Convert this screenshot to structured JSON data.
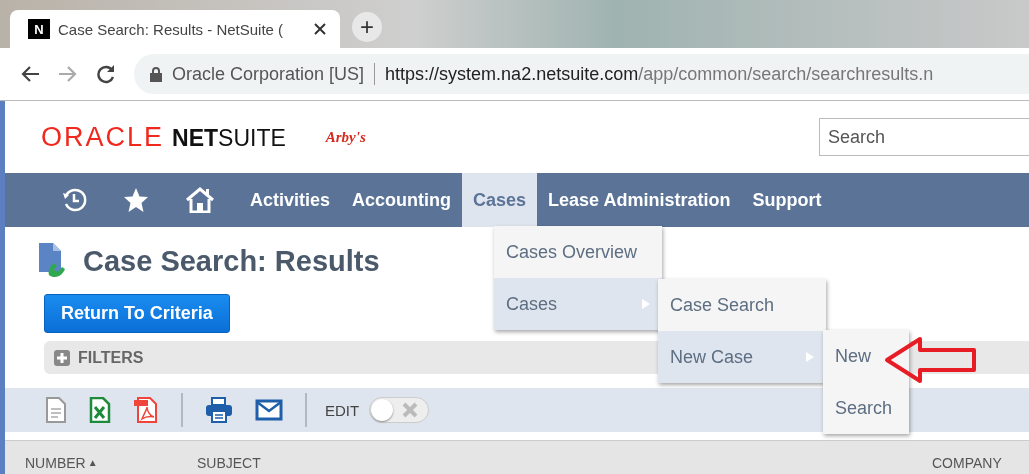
{
  "browser": {
    "tab": {
      "title": "Case Search: Results - NetSuite (",
      "favicon": "N"
    },
    "new_tab": "+",
    "address": {
      "security": "Oracle Corporation [US]",
      "url_host": "https://system.na2.netsuite.com",
      "url_path": "/app/common/search/searchresults.n"
    }
  },
  "header": {
    "logo": {
      "oracle": "ORACLE",
      "net": "NET",
      "suite": "SUITE"
    },
    "company_logo": "Arby's",
    "search": {
      "placeholder": "Search"
    }
  },
  "nav": {
    "icons": [
      {
        "kind": "recent"
      },
      {
        "kind": "star"
      },
      {
        "kind": "home"
      }
    ],
    "items": [
      {
        "label": "Activities",
        "selected": false
      },
      {
        "label": "Accounting",
        "selected": false
      },
      {
        "label": "Cases",
        "selected": true
      },
      {
        "label": "Lease Administration",
        "selected": false
      },
      {
        "label": "Support",
        "selected": false
      }
    ]
  },
  "menus": [
    {
      "items": [
        {
          "label": "Cases Overview",
          "selected": false,
          "submenu": false
        },
        {
          "label": "Cases",
          "selected": true,
          "submenu": true
        }
      ]
    },
    {
      "items": [
        {
          "label": "Case Search",
          "selected": false,
          "submenu": false
        },
        {
          "label": "New Case",
          "selected": true,
          "submenu": true
        }
      ]
    },
    {
      "items": [
        {
          "label": "New",
          "selected": false,
          "submenu": false
        },
        {
          "label": "Search",
          "selected": false,
          "submenu": false
        }
      ]
    }
  ],
  "page": {
    "title": "Case Search: Results",
    "button": "Return To Criteria",
    "filters": {
      "label": "FILTERS",
      "expanded": false
    }
  },
  "toolbar": {
    "icons": [
      {
        "kind": "csv"
      },
      {
        "kind": "excel"
      },
      {
        "kind": "pdf"
      },
      {
        "kind": "separator"
      },
      {
        "kind": "print"
      },
      {
        "kind": "email"
      },
      {
        "kind": "separator"
      }
    ],
    "edit": {
      "label": "EDIT",
      "on": false
    }
  },
  "table": {
    "columns": [
      {
        "label": "NUMBER",
        "sort_mark": "▲"
      },
      {
        "label": "SUBJECT"
      },
      {
        "label": "COMPANY"
      }
    ]
  }
}
